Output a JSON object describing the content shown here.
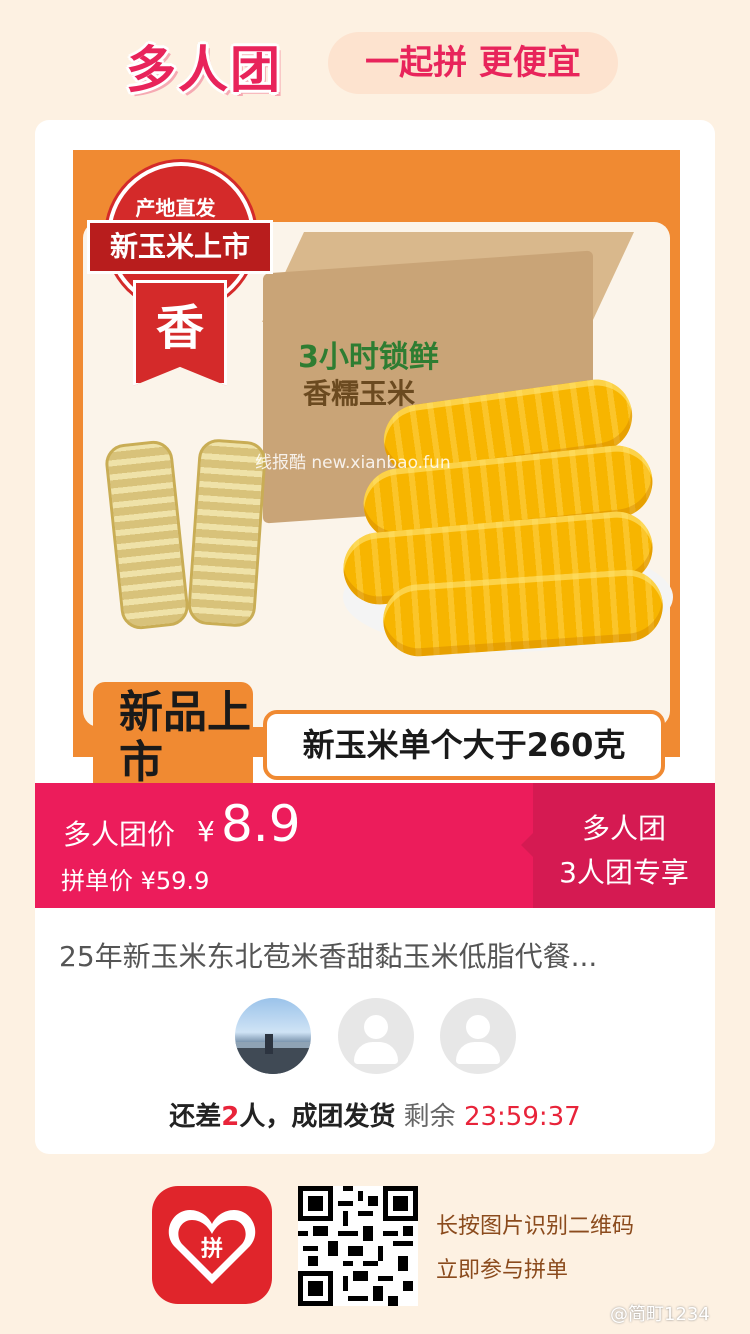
{
  "header": {
    "brand": "多人团",
    "slogan": "一起拼 更便宜"
  },
  "product_image": {
    "badge_top": "产地直发",
    "badge_band": "新玉米上市",
    "badge_ribbon": "香",
    "box_line1": "3小时锁鲜",
    "box_line2": "香糯玉米",
    "new_label": "新品上市",
    "size_label": "新玉米单个大于260克",
    "watermark": "线报酷 new.xianbao.fun"
  },
  "price": {
    "group_label": "多人团价",
    "currency": "¥",
    "group_value": "8.9",
    "single_price": "拼单价 ¥59.9",
    "side_line1": "多人团",
    "side_line2": "3人团专享"
  },
  "product": {
    "title": "25年新玉米东北苞米香甜黏玉米低脂代餐..."
  },
  "group": {
    "status_prefix": "还差",
    "missing_count": "2",
    "status_suffix": "人，成团发货",
    "remaining_label": "剩余",
    "countdown": "23:59:37"
  },
  "footer": {
    "qr_caption_1": "长按图片识别二维码",
    "qr_caption_2": "立即参与拼单",
    "watermark": "@简町1234"
  },
  "colors": {
    "accent": "#ec1c5b",
    "background": "#fdf1e2",
    "countdown": "#e8243a",
    "caption": "#8b4b1d"
  }
}
